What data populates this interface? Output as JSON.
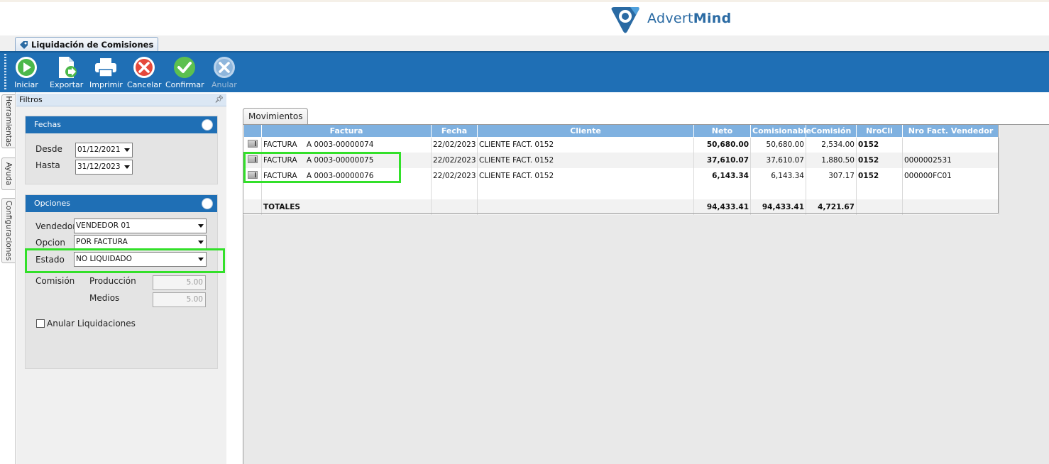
{
  "brand": {
    "name_light": "Advert",
    "name_bold": "Mind"
  },
  "doc_tab": {
    "title": "Liquidación de Comisiones"
  },
  "toolbar": {
    "buttons": [
      {
        "label": "Iniciar",
        "icon": "play-icon",
        "enabled": true
      },
      {
        "label": "Exportar",
        "icon": "export-icon",
        "enabled": true
      },
      {
        "label": "Imprimir",
        "icon": "printer-icon",
        "enabled": true
      },
      {
        "label": "Cancelar",
        "icon": "cancel-icon",
        "enabled": true
      },
      {
        "label": "Confirmar",
        "icon": "check-icon",
        "enabled": true
      },
      {
        "label": "Anular",
        "icon": "close-icon",
        "enabled": false
      }
    ]
  },
  "side_tabs": [
    "Herramientas",
    "Ayuda",
    "Configuraciones"
  ],
  "filters": {
    "title": "Filtros",
    "fechas": {
      "title": "Fechas",
      "desde_label": "Desde",
      "desde_value": "01/12/2021",
      "hasta_label": "Hasta",
      "hasta_value": "31/12/2023"
    },
    "opciones": {
      "title": "Opciones",
      "vendedor_label": "Vendedor",
      "vendedor_value": "VENDEDOR 01",
      "opcion_label": "Opcion",
      "opcion_value": "POR FACTURA",
      "estado_label": "Estado",
      "estado_value": "NO LIQUIDADO",
      "comision_label": "Comisión",
      "produccion_label": "Producción",
      "produccion_value": "5.00",
      "medios_label": "Medios",
      "medios_value": "5.00",
      "anular_label": "Anular Liquidaciones",
      "anular_checked": false
    }
  },
  "main": {
    "tab": "Movimientos",
    "columns": [
      "Factura",
      "Fecha",
      "Cliente",
      "Neto",
      "Comisionable",
      "Comisión",
      "NroCli",
      "Nro Fact. Vendedor"
    ],
    "rows": [
      {
        "factura": "FACTURA    A 0003-00000074",
        "fecha": "22/02/2023",
        "cliente": "CLIENTE FACT. 0152",
        "neto": "50,680.00",
        "comisionable": "50,680.00",
        "comision": "2,534.00",
        "nrocli": "0152",
        "nrofact": ""
      },
      {
        "factura": "FACTURA    A 0003-00000075",
        "fecha": "22/02/2023",
        "cliente": "CLIENTE FACT. 0152",
        "neto": "37,610.07",
        "comisionable": "37,610.07",
        "comision": "1,880.50",
        "nrocli": "0152",
        "nrofact": "0000002531"
      },
      {
        "factura": "FACTURA    A 0003-00000076",
        "fecha": "22/02/2023",
        "cliente": "CLIENTE FACT. 0152",
        "neto": "6,143.34",
        "comisionable": "6,143.34",
        "comision": "307.17",
        "nrocli": "0152",
        "nrofact": "000000FC01"
      }
    ],
    "totals": {
      "label": "TOTALES",
      "neto": "94,433.41",
      "comisionable": "94,433.41",
      "comision": "4,721.67"
    }
  },
  "colors": {
    "toolbar_blue": "#1f6fb5",
    "header_blue": "#7fb1e0",
    "highlight_green": "#33e02a"
  }
}
